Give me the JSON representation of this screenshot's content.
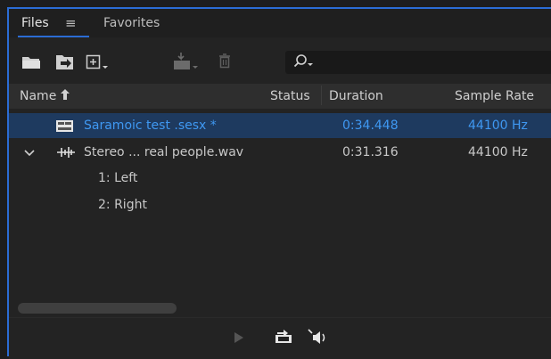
{
  "tabs": {
    "files": "Files",
    "menu_icon": "≡",
    "favorites": "Favorites"
  },
  "search": {
    "placeholder": ""
  },
  "columns": {
    "name": "Name",
    "status": "Status",
    "duration": "Duration",
    "sample_rate": "Sample Rate"
  },
  "rows": [
    {
      "name": "Saramoic test .sesx *",
      "duration": "0:34.448",
      "sample_rate": "44100 Hz",
      "icon": "multitrack-session-icon",
      "selected": true
    },
    {
      "name": "Stereo ... real people.wav",
      "duration": "0:31.316",
      "sample_rate": "44100 Hz",
      "icon": "waveform-icon",
      "expanded": true
    },
    {
      "name": "1: Left"
    },
    {
      "name": "2: Right"
    }
  ],
  "colors": {
    "accent": "#2b6cd4",
    "selected_text": "#3f98f2",
    "selected_row": "#1e3a5f"
  }
}
